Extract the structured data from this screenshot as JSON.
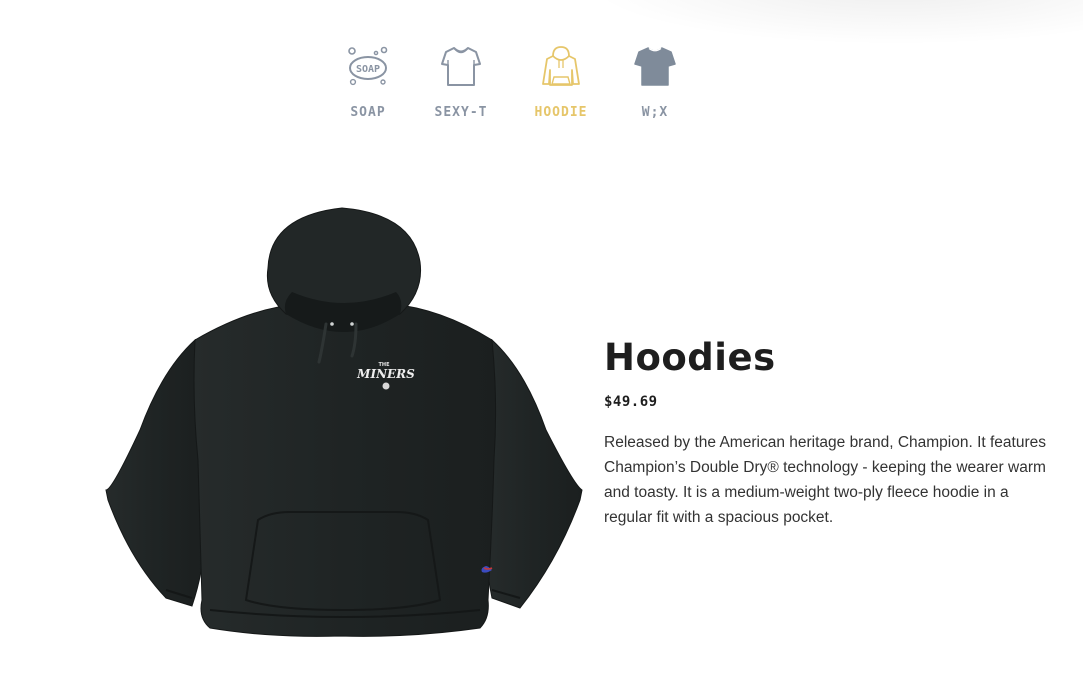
{
  "categories": [
    {
      "label": "SOAP",
      "icon": "soap-icon",
      "active": false
    },
    {
      "label": "SEXY-T",
      "icon": "tshirt-outline-icon",
      "active": false
    },
    {
      "label": "HOODIE",
      "icon": "hoodie-icon",
      "active": true
    },
    {
      "label": "W;X",
      "icon": "tshirt-filled-icon",
      "active": false
    }
  ],
  "icon_text": {
    "soap": "SOAP"
  },
  "product": {
    "title": "Hoodies",
    "price": "$49.69",
    "description": "Released by the American heritage brand, Champion. It features Champion’s Double Dry® technology - keeping the wearer warm and toasty. It is a medium-weight two-ply fleece hoodie in a regular fit with a spacious pocket.",
    "image": {
      "icon": "hoodie-product-image",
      "print_small": "THE",
      "print_main": "MINERS"
    }
  },
  "colors": {
    "inactive": "#8a94a3",
    "active": "#e6c66a",
    "garment": "#1f2424",
    "text": "#1e1e1e"
  }
}
